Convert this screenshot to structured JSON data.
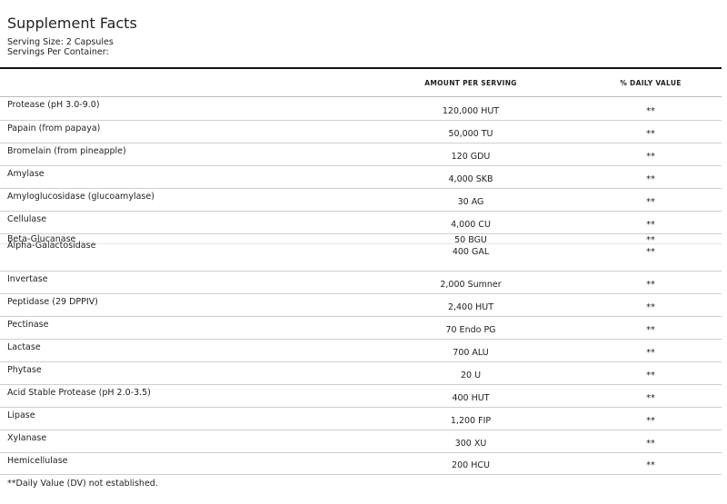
{
  "title": "Supplement Facts",
  "serving_size": "Serving Size: 2 Capsules",
  "servings_per_container": "Servings Per Container:",
  "columns": {
    "amount": "AMOUNT PER SERVING",
    "daily_value": "% DAILY VALUE"
  },
  "rows": [
    {
      "name": "Protease (pH 3.0-9.0)",
      "amount": "120,000 HUT",
      "dv": "**"
    },
    {
      "name": "Papain (from papaya)",
      "amount": "50,000 TU",
      "dv": "**"
    },
    {
      "name": "Bromelain (from pineapple)",
      "amount": "120 GDU",
      "dv": "**"
    },
    {
      "name": "Amylase",
      "amount": "4,000 SKB",
      "dv": "**"
    },
    {
      "name": "Amyloglucosidase (glucoamylase)",
      "amount": "30 AG",
      "dv": "**"
    },
    {
      "name": "Cellulase",
      "amount": "4,000 CU",
      "dv": "**"
    },
    {
      "name": "Beta-Glucanase",
      "amount": "50 BGU",
      "dv": "**"
    },
    {
      "name": "Alpha-Galactosidase",
      "amount": "400 GAL",
      "dv": "**"
    },
    {
      "name": "Invertase",
      "amount": "2,000 Sumner",
      "dv": "**"
    },
    {
      "name": "Peptidase (29 DPPIV)",
      "amount": "2,400 HUT",
      "dv": "**"
    },
    {
      "name": "Pectinase",
      "amount": "70 Endo PG",
      "dv": "**"
    },
    {
      "name": "Lactase",
      "amount": "700 ALU",
      "dv": "**"
    },
    {
      "name": "Phytase",
      "amount": "20 U",
      "dv": "**"
    },
    {
      "name": "Acid Stable Protease (pH 2.0-3.5)",
      "amount": "400 HUT",
      "dv": "**"
    },
    {
      "name": "Lipase",
      "amount": "1,200 FIP",
      "dv": "**"
    },
    {
      "name": "Xylanase",
      "amount": "300 XU",
      "dv": "**"
    },
    {
      "name": "Hemicellulase",
      "amount": "200 HCU",
      "dv": "**"
    }
  ],
  "footnote": "**Daily Value (DV) not established."
}
